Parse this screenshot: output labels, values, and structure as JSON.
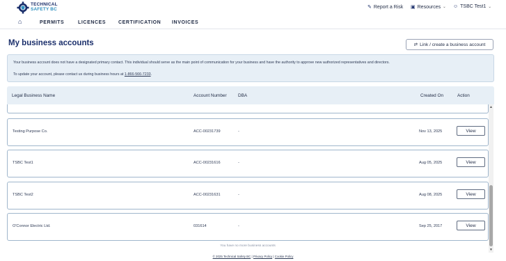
{
  "header": {
    "brand_line1": "TECHNICAL",
    "brand_line2": "SAFETY BC",
    "logo_icon": "gear-shield-icon",
    "report_label": "Report a Risk",
    "resources_label": "Resources",
    "user_label": "TSBC Test1"
  },
  "nav": {
    "home_icon": "home-icon",
    "items": [
      {
        "label": "PERMITS"
      },
      {
        "label": "LICENCES"
      },
      {
        "label": "CERTIFICATION"
      },
      {
        "label": "INVOICES"
      }
    ]
  },
  "page": {
    "title": "My business accounts",
    "link_button": "Link / create a business account"
  },
  "notice": {
    "line1": "Your business account does not have a designated primary contact. This individual should serve as the main point of communication for your business and have the authority to approve new authorized representatives and directors.",
    "line2_prefix": "To update your account, please contact us during business hours at ",
    "phone": "1-866-566-7233",
    "line2_suffix": "."
  },
  "table": {
    "headers": {
      "name": "Legal Business Name",
      "account": "Account Number",
      "dba": "DBA",
      "created": "Created On",
      "action": "Action"
    },
    "rows": [
      {
        "name": "Testing Purpose Co.",
        "account": "ACC-00231739",
        "dba": "-",
        "created": "Nov 13, 2025",
        "action": "View"
      },
      {
        "name": "TSBC Test1",
        "account": "ACC-00231616",
        "dba": "-",
        "created": "Aug 05, 2025",
        "action": "View"
      },
      {
        "name": "TSBC Test2",
        "account": "ACC-00231631",
        "dba": "-",
        "created": "Aug 08, 2025",
        "action": "View"
      },
      {
        "name": "O'Connor Electric Ltd.",
        "account": "031614",
        "dba": "-",
        "created": "Sep 25, 2017",
        "action": "View"
      }
    ],
    "end_message": "You have no more business accounts"
  },
  "footer": {
    "copyright": "© 2025 Technical Safety BC",
    "privacy": "Privacy Policy",
    "cookie": "Cookie Policy",
    "separator": "|"
  }
}
